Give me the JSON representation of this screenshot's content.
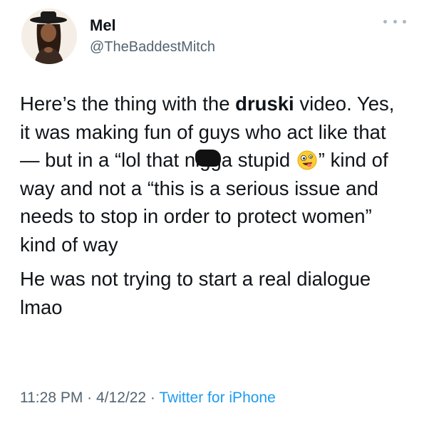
{
  "author": {
    "display_name": "Mel",
    "handle": "@TheBaddestMitch"
  },
  "tweet": {
    "p1_a": "Here’s the thing with the ",
    "mention": "druski",
    "p1_b": " video. Yes, it was making fun of guys who act like that — but in a “lol that ",
    "censored_word": "nigga",
    "p1_c": " stupid ",
    "emoji": "zany-face-emoji",
    "p1_d": "” kind of way and not a “this is a serious issue and needs to stop in order to protect women” kind of way",
    "p2": "He was not trying to start a real dialogue lmao"
  },
  "meta": {
    "time": "11:28 PM",
    "sep1": " · ",
    "date": "4/12/22",
    "sep2": " · ",
    "source": "Twitter for iPhone"
  },
  "colors": {
    "text": "#0f1419",
    "secondary": "#536471",
    "link": "#1d9bf0"
  }
}
